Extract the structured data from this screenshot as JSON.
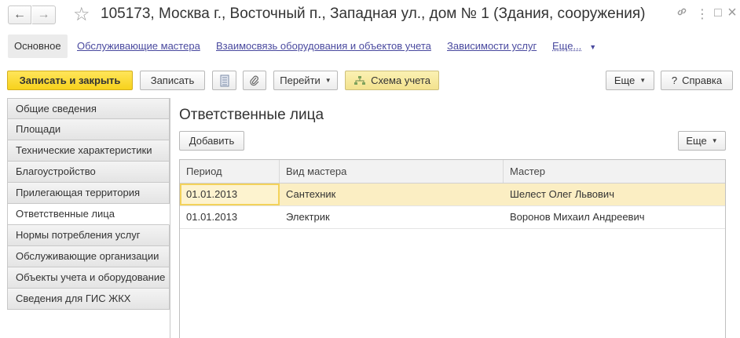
{
  "window": {
    "back_icon": "←",
    "forward_icon": "→",
    "star_icon": "☆",
    "title": "105173, Москва г., Восточный п., Западная ул., дом № 1 (Здания, сооружения)",
    "link_icon": "🔗",
    "menu_icon": "⋮",
    "restore_icon": "□",
    "close_icon": "×"
  },
  "tabs": {
    "main": "Основное",
    "masters": "Обслуживающие мастера",
    "relation": "Взаимосвязь оборудования и объектов учета",
    "dependencies": "Зависимости услуг",
    "more": "Еще..."
  },
  "toolbar": {
    "save_close": "Записать и закрыть",
    "save": "Записать",
    "goto": "Перейти",
    "scheme": "Схема учета",
    "more": "Еще",
    "help": "Справка"
  },
  "sidebar": {
    "items": [
      {
        "label": "Общие сведения"
      },
      {
        "label": "Площади"
      },
      {
        "label": "Технические характеристики"
      },
      {
        "label": "Благоустройство"
      },
      {
        "label": "Прилегающая территория"
      },
      {
        "label": "Ответственные лица"
      },
      {
        "label": "Нормы потребления услуг"
      },
      {
        "label": "Обслуживающие организации"
      },
      {
        "label": "Объекты учета и оборудование"
      },
      {
        "label": "Сведения для ГИС ЖКХ"
      }
    ]
  },
  "main": {
    "section_title": "Ответственные лица",
    "add_button": "Добавить",
    "more_button": "Еще"
  },
  "table": {
    "columns": [
      "Период",
      "Вид мастера",
      "Мастер"
    ],
    "rows": [
      {
        "period": "01.01.2013",
        "kind": "Сантехник",
        "master": "Шелест Олег Львович"
      },
      {
        "period": "01.01.2013",
        "kind": "Электрик",
        "master": "Воронов Михаил Андреевич"
      }
    ]
  }
}
